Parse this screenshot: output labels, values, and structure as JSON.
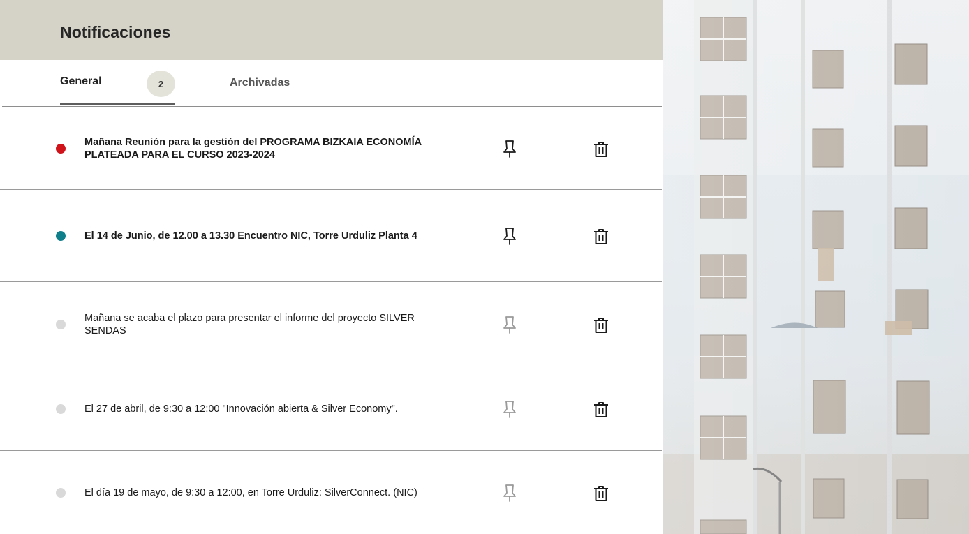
{
  "header": {
    "title": "Notificaciones"
  },
  "tabs": {
    "general": {
      "label": "General",
      "count": "2"
    },
    "archived": {
      "label": "Archivadas"
    }
  },
  "notifications": [
    {
      "text": "Mañana Reunión para la gestión del  PROGRAMA BIZKAIA ECONOMÍA PLATEADA PARA EL CURSO 2023-2024",
      "unread": true,
      "status_color": "#d0121b",
      "pinned": true
    },
    {
      "text": "El 14 de Junio, de  12.00 a 13.30 Encuentro NIC, Torre Urduliz Planta 4",
      "unread": true,
      "status_color": "#0f7f8b",
      "pinned": true
    },
    {
      "text": "Mañana se acaba el plazo para presentar el informe del proyecto SILVER SENDAS",
      "unread": false,
      "status_color": "#d9d9d9",
      "pinned": false
    },
    {
      "text": "El  27 de abril, de 9:30 a 12:00 \"Innovación abierta & Silver Economy\".",
      "unread": false,
      "status_color": "#d9d9d9",
      "pinned": false
    },
    {
      "text": "El día 19 de mayo, de 9:30 a 12:00, en Torre Urduliz: SilverConnect. (NIC)",
      "unread": false,
      "status_color": "#d9d9d9",
      "pinned": false
    }
  ],
  "icons": {
    "pin": "pin-icon",
    "delete": "trash-icon"
  },
  "colors": {
    "header_bg": "#d5d3c8",
    "active_pin": "#1a1a1a",
    "inactive_pin": "#9a9a9a"
  },
  "image": {
    "description_name": "building-photo"
  }
}
